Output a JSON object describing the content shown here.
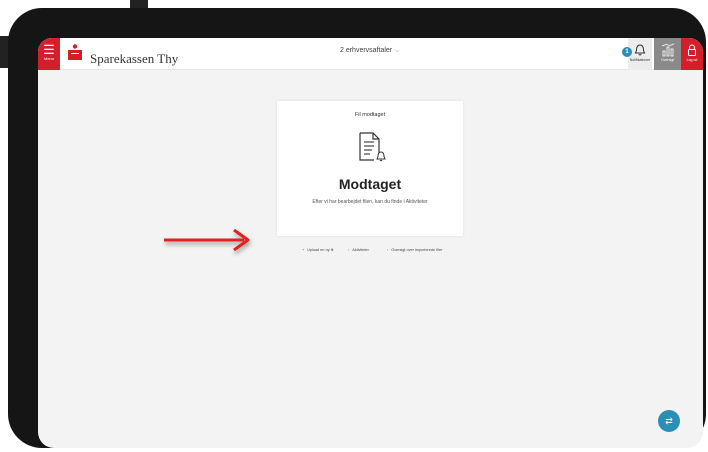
{
  "app": {
    "menu_label": "Menu",
    "bank_name": "Sparekassen Thy",
    "agreements_selector": "2 erhvervsaftaler",
    "notification_count": "1",
    "notification_label": "Notifikationer",
    "overview_label": "Oversigt",
    "logout_label": "Log ud"
  },
  "card": {
    "title": "Fil modtaget",
    "heading": "Modtaget",
    "description": "Efter vi har bearbejdet filen, kan du finde i Aktiviteter"
  },
  "links": {
    "upload_new": "Upload en ny fil",
    "activities": "Aktiviteter",
    "imported_files": "Oversigt over importerede filer"
  },
  "colors": {
    "brand_red": "#d2202b",
    "accent_blue": "#2a8fb5",
    "annotation_arrow": "#e02020"
  },
  "icons": {
    "menu": "hamburger-icon",
    "bell": "bell-icon",
    "overview": "bar-chart-icon",
    "logout": "lock-icon",
    "document": "document-bell-icon",
    "fab": "swap-arrows-icon"
  }
}
